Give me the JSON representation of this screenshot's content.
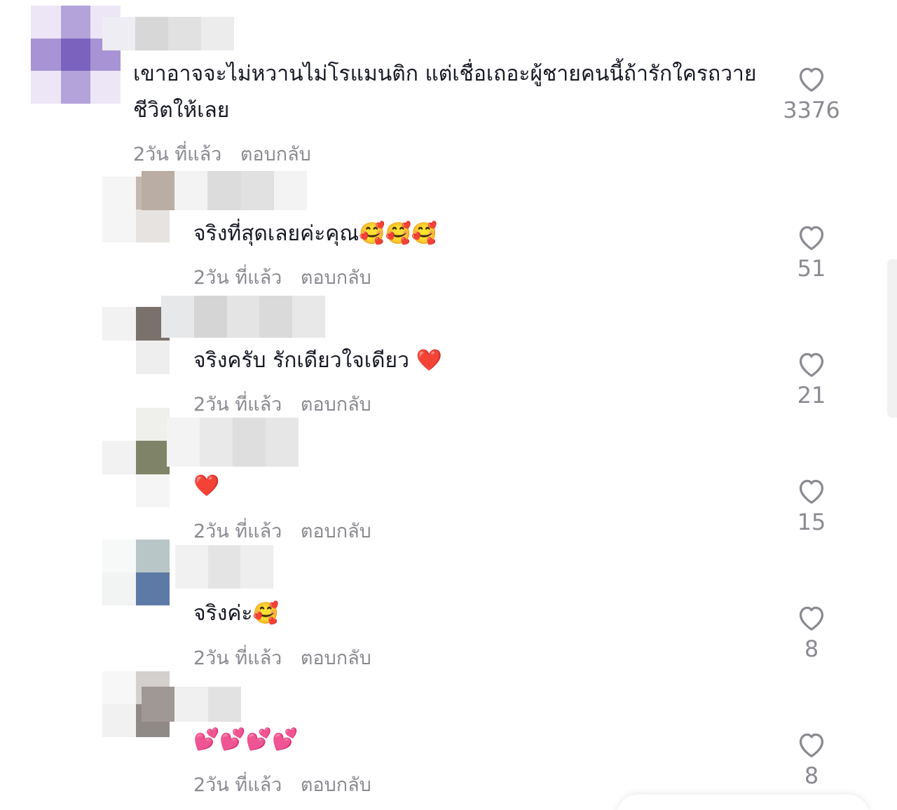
{
  "comments": [
    {
      "text": "เขาอาจจะไม่หวานไม่โรแมนติก แต่เชื่อเถอะผู้ชายคนนี้ถ้ารักใครถวายชีวิตให้เลย",
      "time": "2วัน ที่แล้ว",
      "reply": "ตอบกลับ",
      "likes": "3376"
    }
  ],
  "replies": [
    {
      "text": "จริงที่สุดเลยค่ะคุณ🥰🥰🥰",
      "time": "2วัน ที่แล้ว",
      "reply": "ตอบกลับ",
      "likes": "51"
    },
    {
      "text": "จริงครับ รักเดียวใจเดียว ❤️",
      "time": "2วัน ที่แล้ว",
      "reply": "ตอบกลับ",
      "likes": "21"
    },
    {
      "text": "❤️",
      "time": "2วัน ที่แล้ว",
      "reply": "ตอบกลับ",
      "likes": "15"
    },
    {
      "text": "จริงค่ะ🥰",
      "time": "2วัน ที่แล้ว",
      "reply": "ตอบกลับ",
      "likes": "8"
    },
    {
      "text": "💕💕💕💕",
      "time": "2วัน ที่แล้ว",
      "reply": "ตอบกลับ",
      "likes": "8"
    }
  ],
  "icons": {
    "like": "heart-outline-icon"
  },
  "colors": {
    "text": "#161823",
    "meta": "#8a8b91"
  }
}
